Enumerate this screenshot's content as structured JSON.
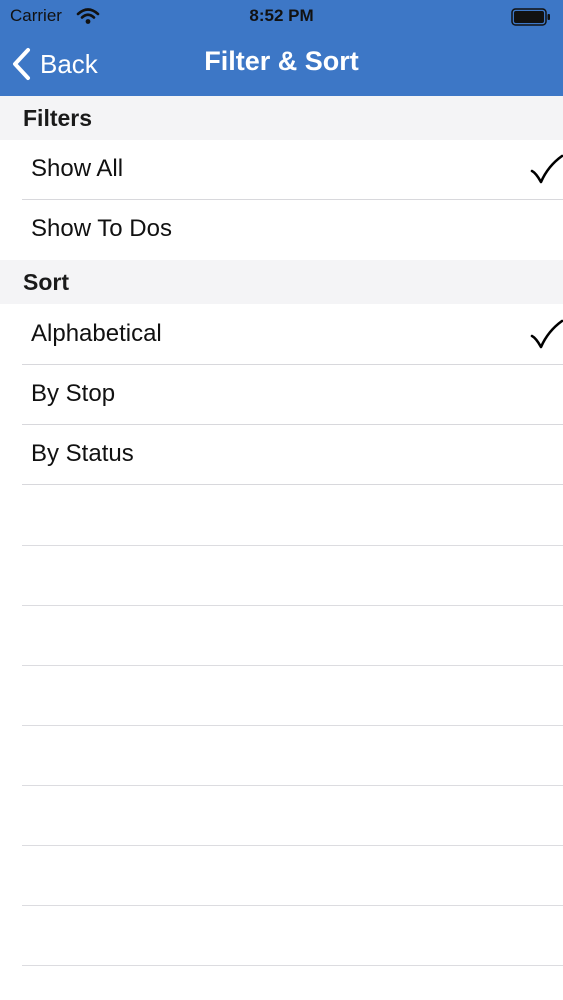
{
  "status_bar": {
    "carrier": "Carrier",
    "time": "8:52 PM"
  },
  "nav_bar": {
    "back_label": "Back",
    "title": "Filter & Sort",
    "accent_color": "#3d77c6"
  },
  "sections": {
    "filters": {
      "header": "Filters",
      "items": [
        {
          "label": "Show All",
          "checked": true
        },
        {
          "label": "Show To Dos",
          "checked": false
        }
      ]
    },
    "sort": {
      "header": "Sort",
      "items": [
        {
          "label": "Alphabetical",
          "checked": true
        },
        {
          "label": "By Stop",
          "checked": false
        },
        {
          "label": "By Status",
          "checked": false
        }
      ]
    }
  },
  "icons": {
    "wifi": "wifi-icon",
    "battery": "battery-icon",
    "back": "chevron-left-icon",
    "checkmark": "checkmark-icon"
  }
}
